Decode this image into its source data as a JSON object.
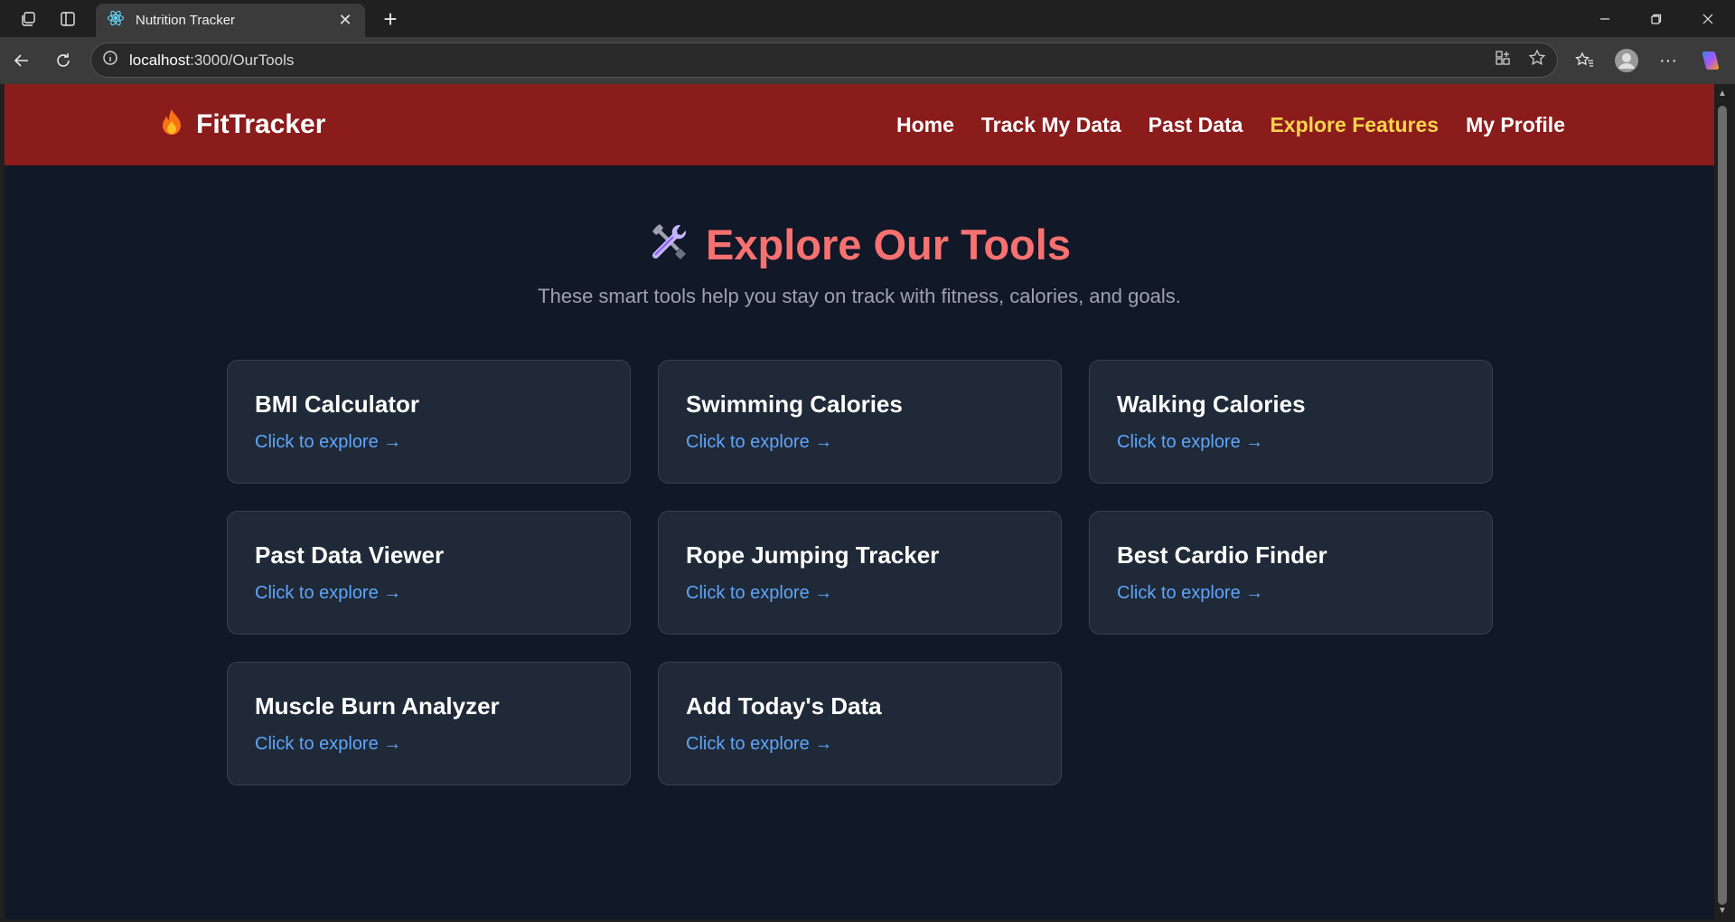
{
  "browser": {
    "tab_title": "Nutrition Tracker",
    "url_host": "localhost",
    "url_path": ":3000/OurTools"
  },
  "navbar": {
    "brand": "FitTracker",
    "links": [
      {
        "label": "Home",
        "active": false
      },
      {
        "label": "Track My Data",
        "active": false
      },
      {
        "label": "Past Data",
        "active": false
      },
      {
        "label": "Explore Features",
        "active": true
      },
      {
        "label": "My Profile",
        "active": false
      }
    ]
  },
  "hero": {
    "title": "Explore Our Tools",
    "subtitle": "These smart tools help you stay on track with fitness, calories, and goals."
  },
  "cards": [
    {
      "title": "BMI Calculator",
      "link": "Click to explore →"
    },
    {
      "title": "Swimming Calories",
      "link": "Click to explore →"
    },
    {
      "title": "Walking Calories",
      "link": "Click to explore →"
    },
    {
      "title": "Past Data Viewer",
      "link": "Click to explore →"
    },
    {
      "title": "Rope Jumping Tracker",
      "link": "Click to explore →"
    },
    {
      "title": "Best Cardio Finder",
      "link": "Click to explore →"
    },
    {
      "title": "Muscle Burn Analyzer",
      "link": "Click to explore →"
    },
    {
      "title": "Add Today's Data",
      "link": "Click to explore →"
    }
  ],
  "colors": {
    "navbar_bg": "#8b1c1c",
    "page_bg": "#111827",
    "card_bg": "#1f2937",
    "title_accent": "#f87171",
    "active_link": "#fcd34d",
    "explore_link": "#60a5fa"
  }
}
